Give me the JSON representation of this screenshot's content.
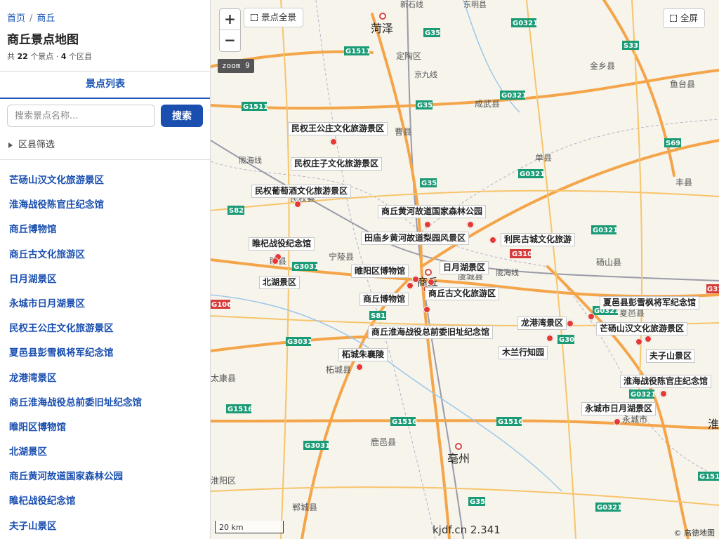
{
  "breadcrumb": {
    "home": "首页",
    "current": "商丘"
  },
  "title": "商丘景点地图",
  "stats": {
    "prefix": "共",
    "spots": "22",
    "spots_unit": "个景点",
    "dot": "·",
    "districts": "4",
    "districts_unit": "个区县"
  },
  "tab": "景点列表",
  "search": {
    "placeholder": "搜索景点名称...",
    "button": "搜索"
  },
  "filter_label": "区县筛选",
  "spots": [
    "芒砀山汉文化旅游景区",
    "淮海战役陈官庄纪念馆",
    "商丘博物馆",
    "商丘古文化旅游区",
    "日月湖景区",
    "永城市日月湖景区",
    "民权王公庄文化旅游景区",
    "夏邑县彭雪枫将军纪念馆",
    "龙港湾景区",
    "商丘淮海战役总前委旧址纪念馆",
    "睢阳区博物馆",
    "北湖景区",
    "商丘黄河故道国家森林公园",
    "睢杞战役纪念馆",
    "夫子山景区"
  ],
  "map": {
    "zoom_in": "+",
    "zoom_out": "−",
    "fit_all": "景点全景",
    "fullscreen": "全屏",
    "zoom_badge": "zoom 9",
    "scale": "20 km",
    "watermark": "kjdf.cn 2.341",
    "attribution": "© 高德地图",
    "pois": [
      "民权王公庄文化旅游景区",
      "民权庄子文化旅游景区",
      "民权葡萄酒文化旅游景区",
      "商丘黄河故道国家森林公园",
      "田庙乡黄河故道梨园风景区",
      "利民古城文化旅游",
      "睢杞战役纪念馆",
      "日月湖景区",
      "睢阳区博物馆",
      "北湖景区",
      "商丘古文化旅游区",
      "商丘博物馆",
      "商丘淮海战役总前委旧址纪念馆",
      "龙港湾景区",
      "木兰行知园",
      "柘城朱襄陵",
      "夏邑县彭雪枫将军纪念馆",
      "芒砀山汉文化旅游景区",
      "夫子山景区",
      "淮海战役陈官庄纪念馆",
      "永城市日月湖景区"
    ],
    "places": [
      "菏泽",
      "定陶区",
      "曹县",
      "成武县",
      "金乡县",
      "鱼台县",
      "单县",
      "丰县",
      "民权县",
      "宁陵县",
      "睢县",
      "商丘",
      "虞城县",
      "砀山县",
      "柘城县",
      "夏邑县",
      "永城市",
      "鹿邑县",
      "亳州",
      "郸城县",
      "太康县",
      "淮阳区",
      "东明县",
      "新石线",
      "京九线",
      "陇海线",
      "淮"
    ],
    "road_shields": [
      "G35",
      "G0321",
      "G1511",
      "S82",
      "G3031",
      "S81",
      "G310",
      "G106",
      "G1516",
      "S33",
      "S69",
      "G30",
      "G311",
      "G344"
    ]
  }
}
